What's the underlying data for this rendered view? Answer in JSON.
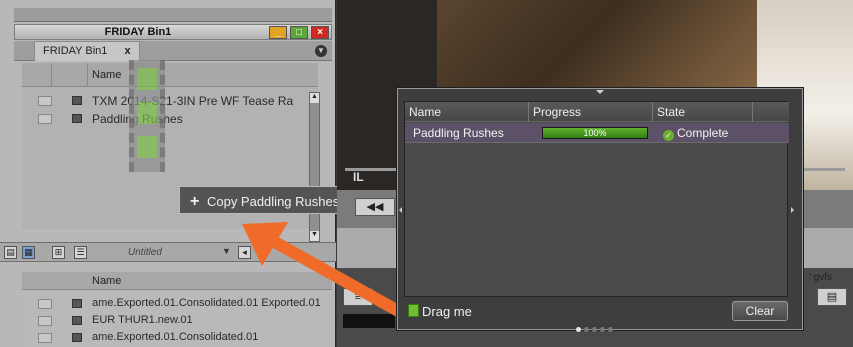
{
  "bin": {
    "title": "FRIDAY Bin1",
    "tab_label": "FRIDAY Bin1",
    "tab_close": "x",
    "column_name": "Name",
    "items": [
      {
        "label": "TXM 2014-S21-3IN Pre WF Tease Ra"
      },
      {
        "label": "Paddling Rushes"
      }
    ],
    "untitled_label": "Untitled",
    "bottom_column_name": "Name",
    "bottom_items": [
      {
        "label": "ame.Exported.01.Consolidated.01 Exported.01"
      },
      {
        "label": "EUR THUR1.new.01"
      },
      {
        "label": "ame.Exported.01.Consolidated.01"
      }
    ]
  },
  "tooltip": {
    "plus": "+",
    "text": "Copy Paddling Rushes"
  },
  "video": {
    "overlay_text": "IL"
  },
  "right_panel": {
    "rewind": "◀◀",
    "gvf_label": "' gvfs",
    "x_label": "x"
  },
  "dialog": {
    "columns": {
      "name": "Name",
      "progress": "Progress",
      "state": "State"
    },
    "rows": [
      {
        "name": "Paddling Rushes",
        "progress_text": "100%",
        "progress_fraction": 1.0,
        "state": "Complete"
      }
    ],
    "drag_label": "Drag me",
    "clear_label": "Clear",
    "page_dots": 5,
    "active_dot": 0
  },
  "colors": {
    "progress_green": "#4f9a22",
    "arrow_orange": "#f06a2a",
    "check_green": "#6bb02f"
  }
}
